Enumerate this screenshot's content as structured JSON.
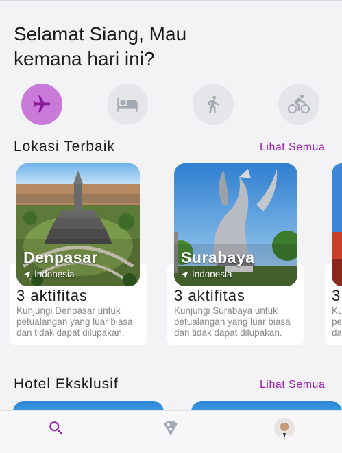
{
  "greeting": {
    "line1": "Selamat Siang, Mau",
    "line2": "kemana hari ini?"
  },
  "categories": [
    {
      "icon": "airplane-icon",
      "active": true
    },
    {
      "icon": "bed-icon",
      "active": false
    },
    {
      "icon": "walking-icon",
      "active": false
    },
    {
      "icon": "bicycle-icon",
      "active": false
    }
  ],
  "best_locations": {
    "title": "Lokasi Terbaik",
    "see_all": "Lihat Semua",
    "items": [
      {
        "city": "Denpasar",
        "country": "Indonesia",
        "count": "3 aktifitas",
        "description": "Kunjungi Denpasar untuk petualangan yang luar biasa dan tidak dapat dilupakan."
      },
      {
        "city": "Surabaya",
        "country": "Indonesia",
        "count": "3 aktifitas",
        "description": "Kunjungi Surabaya untuk petualangan yang luar biasa dan tidak dapat dilupakan."
      },
      {
        "city": "",
        "country": "",
        "count": "3",
        "description": "Ku pe da"
      }
    ]
  },
  "exclusive_hotels": {
    "title": "Hotel Eksklusif",
    "see_all": "Lihat Semua"
  },
  "bottom_nav": [
    {
      "icon": "search-icon",
      "active": true
    },
    {
      "icon": "pizza-icon",
      "active": false
    },
    {
      "icon": "avatar",
      "active": false
    }
  ],
  "colors": {
    "accent": "#9a1fb0",
    "active_category": "#c97ad8",
    "inactive_category": "#e6e6ea",
    "icon_inactive": "#a4aab3"
  }
}
